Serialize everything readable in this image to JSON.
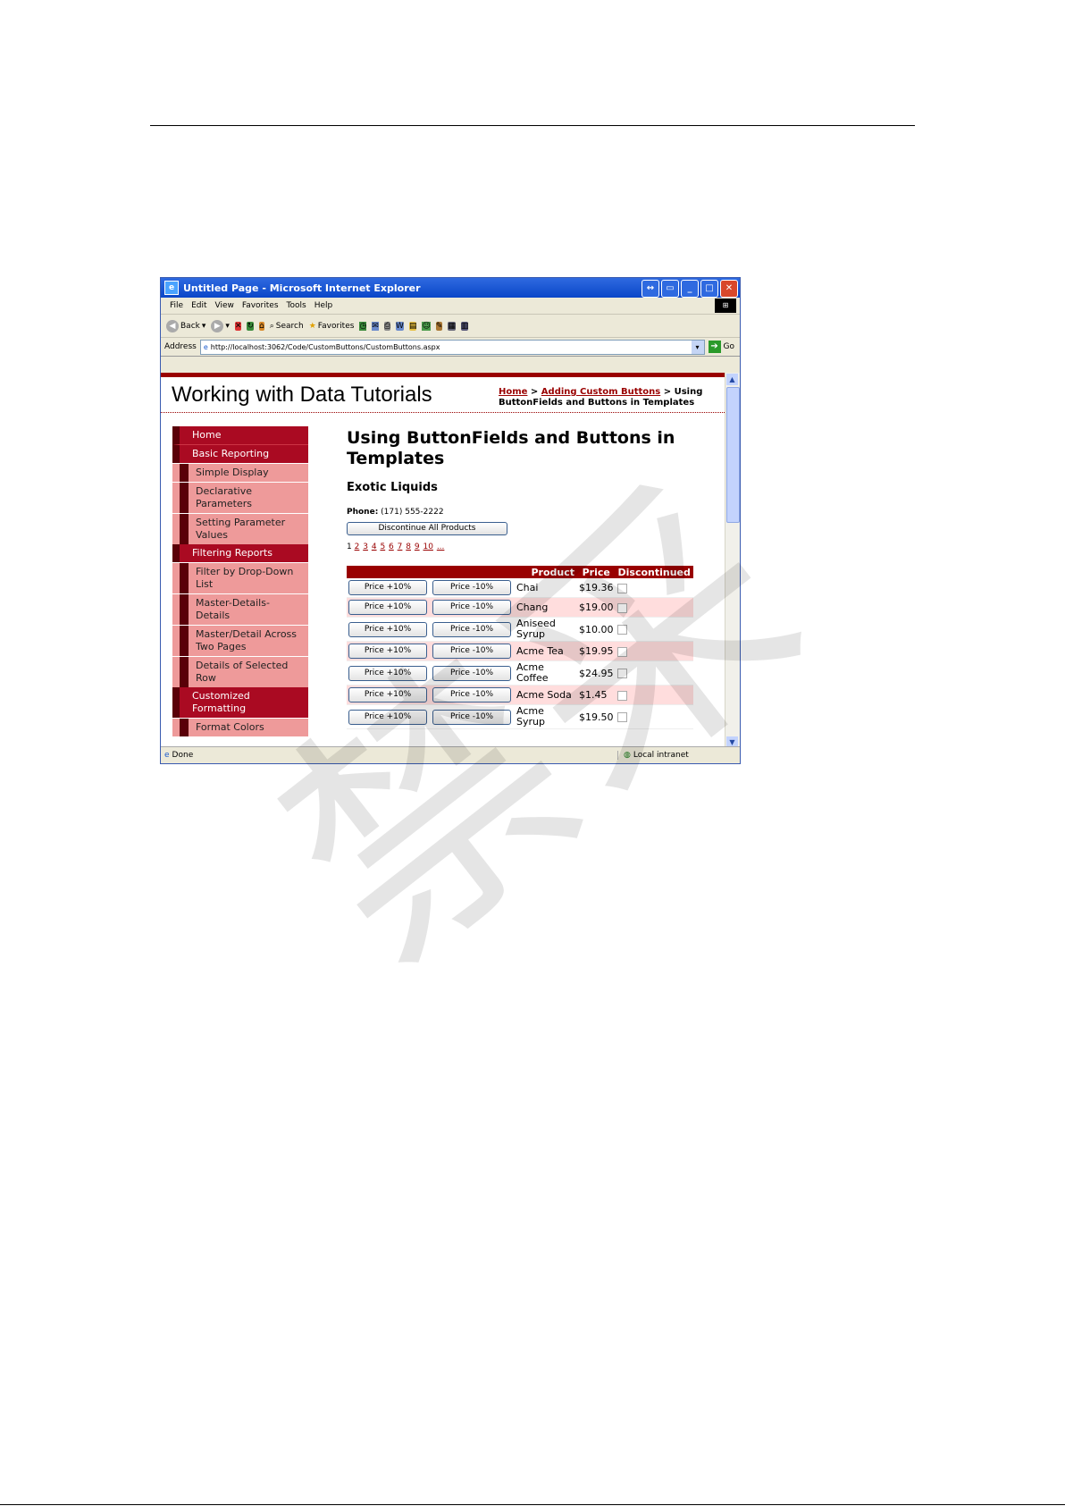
{
  "browser": {
    "title": "Untitled Page - Microsoft Internet Explorer",
    "menu": [
      "File",
      "Edit",
      "View",
      "Favorites",
      "Tools",
      "Help"
    ],
    "toolbar": {
      "back": "Back",
      "search": "Search",
      "favorites": "Favorites"
    },
    "address_label": "Address",
    "address": "http://localhost:3062/Code/CustomButtons/CustomButtons.aspx",
    "go": "Go",
    "status": "Done",
    "zone": "Local intranet"
  },
  "site": {
    "title": "Working with Data Tutorials",
    "breadcrumb": {
      "home": "Home",
      "sep1": " > ",
      "parent": "Adding Custom Buttons",
      "sep2": " > ",
      "current": "Using ButtonFields and Buttons in Templates"
    }
  },
  "menu": [
    {
      "label": "Home",
      "level": 1
    },
    {
      "label": "Basic Reporting",
      "level": 1
    },
    {
      "label": "Simple Display",
      "level": 2
    },
    {
      "label": "Declarative Parameters",
      "level": 2
    },
    {
      "label": "Setting Parameter Values",
      "level": 2
    },
    {
      "label": "Filtering Reports",
      "level": 1
    },
    {
      "label": "Filter by Drop-Down List",
      "level": 2
    },
    {
      "label": "Master-Details-Details",
      "level": 2
    },
    {
      "label": "Master/Detail Across Two Pages",
      "level": 2
    },
    {
      "label": "Details of Selected Row",
      "level": 2
    },
    {
      "label": "Customized Formatting",
      "level": 1
    },
    {
      "label": "Format Colors",
      "level": 2
    }
  ],
  "main": {
    "heading": "Using ButtonFields and Buttons in Templates",
    "supplier": "Exotic Liquids",
    "phone_label": "Phone:",
    "phone": "(171) 555-2222",
    "discontinue_button": "Discontinue All Products",
    "pager": {
      "current": "1",
      "pages": [
        "2",
        "3",
        "4",
        "5",
        "6",
        "7",
        "8",
        "9",
        "10",
        "..."
      ]
    }
  },
  "grid": {
    "headers": [
      "",
      "",
      "Product",
      "Price",
      "Discontinued"
    ],
    "increase_label": "Price +10%",
    "decrease_label": "Price -10%",
    "rows": [
      {
        "product": "Chai",
        "price": "$19.36",
        "discontinued": false
      },
      {
        "product": "Chang",
        "price": "$19.00",
        "discontinued": false
      },
      {
        "product": "Aniseed Syrup",
        "price": "$10.00",
        "discontinued": false
      },
      {
        "product": "Acme Tea",
        "price": "$19.95",
        "discontinued": false
      },
      {
        "product": "Acme Coffee",
        "price": "$24.95",
        "discontinued": false
      },
      {
        "product": "Acme Soda",
        "price": "$1.45",
        "discontinued": false
      },
      {
        "product": "Acme Syrup",
        "price": "$19.50",
        "discontinued": false
      }
    ]
  },
  "watermark": "禁采"
}
